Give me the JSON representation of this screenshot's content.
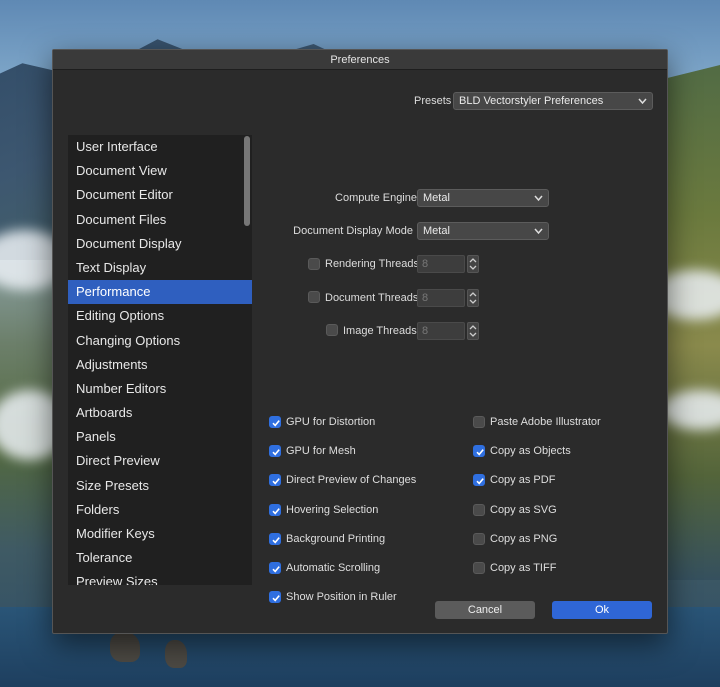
{
  "window": {
    "title": "Preferences"
  },
  "presets": {
    "label": "Presets",
    "selected": "BLD Vectorstyler Preferences"
  },
  "sidebar": {
    "items": [
      {
        "label": "User Interface"
      },
      {
        "label": "Document View"
      },
      {
        "label": "Document Editor"
      },
      {
        "label": "Document Files"
      },
      {
        "label": "Document Display"
      },
      {
        "label": "Text Display"
      },
      {
        "label": "Performance",
        "active": true
      },
      {
        "label": "Editing Options"
      },
      {
        "label": "Changing Options"
      },
      {
        "label": "Adjustments"
      },
      {
        "label": "Number Editors"
      },
      {
        "label": "Artboards"
      },
      {
        "label": "Panels"
      },
      {
        "label": "Direct Preview"
      },
      {
        "label": "Size Presets"
      },
      {
        "label": "Folders"
      },
      {
        "label": "Modifier Keys"
      },
      {
        "label": "Tolerance"
      },
      {
        "label": "Preview Sizes"
      }
    ]
  },
  "performance": {
    "compute_engine": {
      "label": "Compute Engine",
      "value": "Metal"
    },
    "display_mode": {
      "label": "Document Display Mode",
      "value": "Metal"
    },
    "rendering_threads": {
      "label": "Rendering Threads",
      "value": "8",
      "checked": false
    },
    "document_threads": {
      "label": "Document Threads",
      "value": "8",
      "checked": false
    },
    "image_threads": {
      "label": "Image Threads",
      "value": "8",
      "checked": false
    },
    "left_options": [
      {
        "label": "GPU for Distortion",
        "checked": true
      },
      {
        "label": "GPU for Mesh",
        "checked": true
      },
      {
        "label": "Direct Preview of Changes",
        "checked": true
      },
      {
        "label": "Hovering Selection",
        "checked": true
      },
      {
        "label": "Background Printing",
        "checked": true
      },
      {
        "label": "Automatic Scrolling",
        "checked": true
      },
      {
        "label": "Show Position in Ruler",
        "checked": true
      }
    ],
    "right_options": [
      {
        "label": "Paste Adobe Illustrator",
        "checked": false
      },
      {
        "label": "Copy as Objects",
        "checked": true
      },
      {
        "label": "Copy as PDF",
        "checked": true
      },
      {
        "label": "Copy as SVG",
        "checked": false
      },
      {
        "label": "Copy as PNG",
        "checked": false
      },
      {
        "label": "Copy as TIFF",
        "checked": false
      }
    ]
  },
  "buttons": {
    "cancel": "Cancel",
    "ok": "Ok"
  },
  "colors": {
    "accent": "#2f66d6",
    "panel": "#2b2b2b",
    "sidebar": "#202020"
  }
}
